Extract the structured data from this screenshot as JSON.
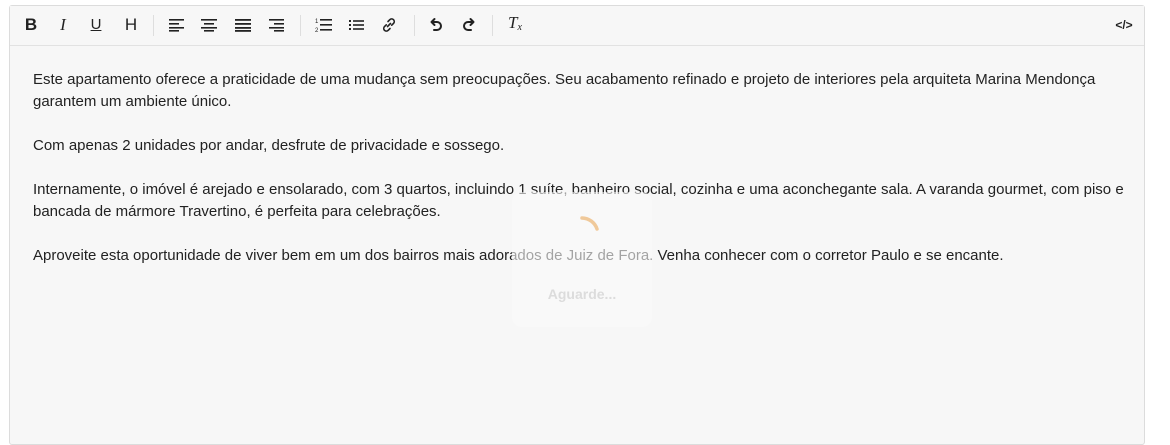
{
  "toolbar": {
    "bold": "B",
    "italic": "I",
    "underline": "U",
    "heading": "H",
    "clear_format": "Tx",
    "source": "</>"
  },
  "content": {
    "paragraphs": [
      "Este apartamento oferece a praticidade de uma mudança sem preocupações. Seu acabamento refinado e projeto de interiores pela arquiteta Marina Mendonça garantem um ambiente único.",
      "Com apenas 2 unidades por andar, desfrute de privacidade e sossego.",
      "Internamente, o imóvel é arejado e ensolarado, com 3 quartos, incluindo 1 suíte, banheiro social, cozinha e uma aconchegante sala. A varanda gourmet, com piso e bancada de mármore Travertino, é perfeita para celebrações.",
      "Aproveite esta oportunidade de viver bem em um dos bairros mais adorados de Juiz de Fora. Venha conhecer com o corretor Paulo e se encante."
    ]
  },
  "loading": {
    "label": "Aguarde...",
    "spinner_color": "#f0c99a"
  },
  "colors": {
    "editor_bg": "#f7f7f7",
    "text": "#222222"
  }
}
